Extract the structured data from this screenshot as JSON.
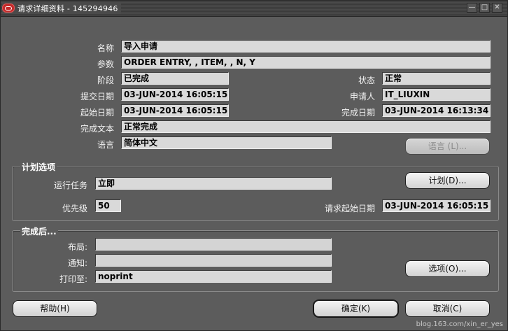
{
  "window": {
    "title": "请求详细资料 - 145294946"
  },
  "details": {
    "name_label": "名称",
    "name_value": "导入申请",
    "params_label": "参数",
    "params_value": "ORDER ENTRY, , ITEM, , N, Y",
    "phase_label": "阶段",
    "phase_value": "已完成",
    "status_label": "状态",
    "status_value": "正常",
    "submitted_label": "提交日期",
    "submitted_value": "03-JUN-2014 16:05:15",
    "requestor_label": "申请人",
    "requestor_value": "IT_LIUXIN",
    "started_label": "起始日期",
    "started_value": "03-JUN-2014 16:05:15",
    "completed_label": "完成日期",
    "completed_value": "03-JUN-2014 16:13:34",
    "completion_text_label": "完成文本",
    "completion_text_value": "正常完成",
    "language_label": "语言",
    "language_value": "简体中文",
    "language_button": "语言 (L)..."
  },
  "schedule": {
    "title": "计划选项",
    "run_job_label": "运行任务",
    "run_job_value": "立即",
    "schedule_button": "计划(D)...",
    "priority_label": "优先级",
    "priority_value": "50",
    "req_start_label": "请求起始日期",
    "req_start_value": "03-JUN-2014 16:05:15"
  },
  "completion": {
    "title": "完成后...",
    "layout_label": "布局:",
    "layout_value": "",
    "notify_label": "通知:",
    "notify_value": "",
    "print_label": "打印至:",
    "print_value": "noprint",
    "options_button": "选项(O)..."
  },
  "footer": {
    "help_button": "帮助(H)",
    "ok_button": "确定(K)",
    "cancel_button": "取消(C)"
  },
  "watermark": "blog.163.com/xin_er_yes"
}
